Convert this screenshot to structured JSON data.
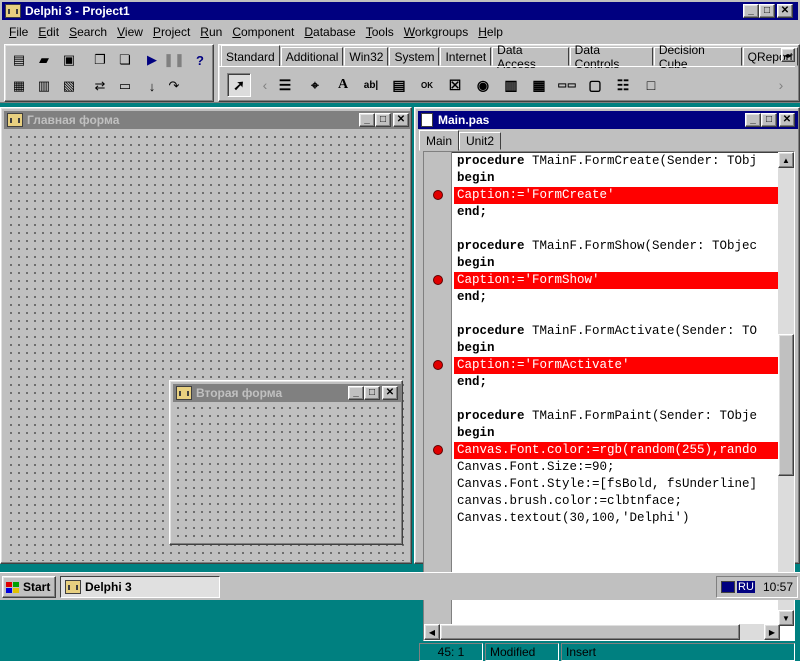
{
  "main_window": {
    "title": "Delphi 3 - Project1",
    "menu": [
      "File",
      "Edit",
      "Search",
      "View",
      "Project",
      "Run",
      "Component",
      "Database",
      "Tools",
      "Workgroups",
      "Help"
    ],
    "menu_underline": [
      "F",
      "E",
      "S",
      "V",
      "P",
      "R",
      "C",
      "D",
      "T",
      "W",
      "H"
    ],
    "palette_tabs": [
      "Standard",
      "Additional",
      "Win32",
      "System",
      "Internet",
      "Data Access",
      "Data Controls",
      "Decision Cube",
      "QReport"
    ],
    "palette_active_tab": "Standard"
  },
  "form1": {
    "title": "Главная форма"
  },
  "form2": {
    "title": "Вторая форма"
  },
  "editor": {
    "title": "Main.pas",
    "tabs": [
      "Main",
      "Unit2"
    ],
    "active_tab": "Main",
    "lines": [
      {
        "text": "procedure TMainF.FormCreate(Sender: TObj",
        "style": "kw-proc"
      },
      {
        "text": "begin",
        "style": "kw"
      },
      {
        "text": "Caption:='FormCreate'",
        "style": "bp"
      },
      {
        "text": "end;",
        "style": "kw"
      },
      {
        "text": "",
        "style": "plain"
      },
      {
        "text": "procedure TMainF.FormShow(Sender: TObjec",
        "style": "kw-proc"
      },
      {
        "text": "begin",
        "style": "kw"
      },
      {
        "text": "Caption:='FormShow'",
        "style": "bp"
      },
      {
        "text": "end;",
        "style": "kw"
      },
      {
        "text": "",
        "style": "plain"
      },
      {
        "text": "procedure TMainF.FormActivate(Sender: TO",
        "style": "kw-proc"
      },
      {
        "text": "begin",
        "style": "kw"
      },
      {
        "text": "Caption:='FormActivate'",
        "style": "bp"
      },
      {
        "text": "end;",
        "style": "kw"
      },
      {
        "text": "",
        "style": "plain"
      },
      {
        "text": "procedure TMainF.FormPaint(Sender: TObje",
        "style": "kw-proc"
      },
      {
        "text": "begin",
        "style": "kw"
      },
      {
        "text": "Canvas.Font.color:=rgb(random(255),rando",
        "style": "bp"
      },
      {
        "text": "Canvas.Font.Size:=90;",
        "style": "plain"
      },
      {
        "text": "Canvas.Font.Style:=[fsBold, fsUnderline]",
        "style": "plain"
      },
      {
        "text": "canvas.brush.color:=clbtnface;",
        "style": "plain"
      },
      {
        "text": "Canvas.textout(30,100,'Delphi')",
        "style": "plain"
      }
    ],
    "status": {
      "position": "45:  1",
      "modified": "Modified",
      "mode": "Insert"
    }
  },
  "taskbar": {
    "start_label": "Start",
    "task_label": "Delphi 3",
    "lang": "RU",
    "clock": "10:57"
  },
  "colors": {
    "titlebar_active": "#000080",
    "titlebar_inactive": "#808080",
    "breakpoint": "#ff0000",
    "desktop": "#008080"
  }
}
